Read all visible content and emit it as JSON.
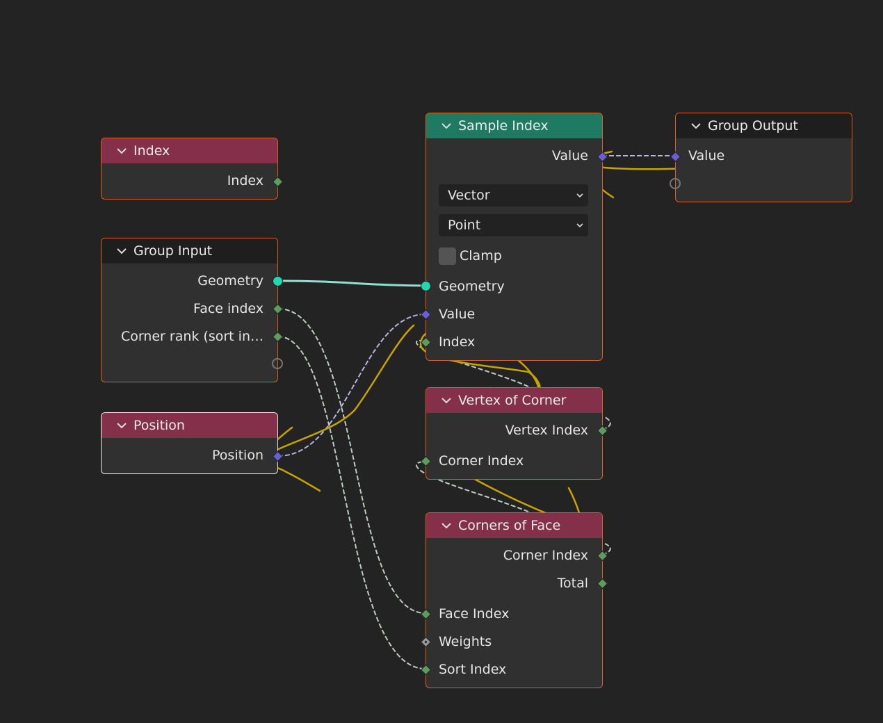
{
  "editor": {
    "type": "Geometry Node Editor",
    "background": "#232323"
  },
  "nodes": {
    "index": {
      "title": "Index",
      "outputs": [
        "Index"
      ]
    },
    "group_input": {
      "title": "Group Input",
      "outputs": [
        "Geometry",
        "Face index",
        "Corner rank (sort in…"
      ]
    },
    "position": {
      "title": "Position",
      "outputs": [
        "Position"
      ]
    },
    "sample_index": {
      "title": "Sample Index",
      "outputs": [
        "Value"
      ],
      "data_type": "Vector",
      "domain": "Point",
      "clamp_label": "Clamp",
      "clamp_checked": false,
      "inputs": [
        "Geometry",
        "Value",
        "Index"
      ]
    },
    "group_output": {
      "title": "Group Output",
      "inputs": [
        "Value"
      ]
    },
    "vertex_of_corner": {
      "title": "Vertex of Corner",
      "outputs": [
        "Vertex Index"
      ],
      "inputs": [
        "Corner Index"
      ]
    },
    "corners_of_face": {
      "title": "Corners of Face",
      "outputs": [
        "Corner Index",
        "Total"
      ],
      "inputs": [
        "Face Index",
        "Weights",
        "Sort Index"
      ]
    }
  },
  "colors": {
    "node_border_selected": "#d9601e",
    "header_input": "#84304a",
    "header_geometry": "#1f7a64",
    "header_group": "#1e1e1e",
    "socket_int": "#5f9a5f",
    "socket_vector": "#6b5fd0",
    "socket_geometry": "#22d6b0",
    "annotation": "#c8a400"
  }
}
